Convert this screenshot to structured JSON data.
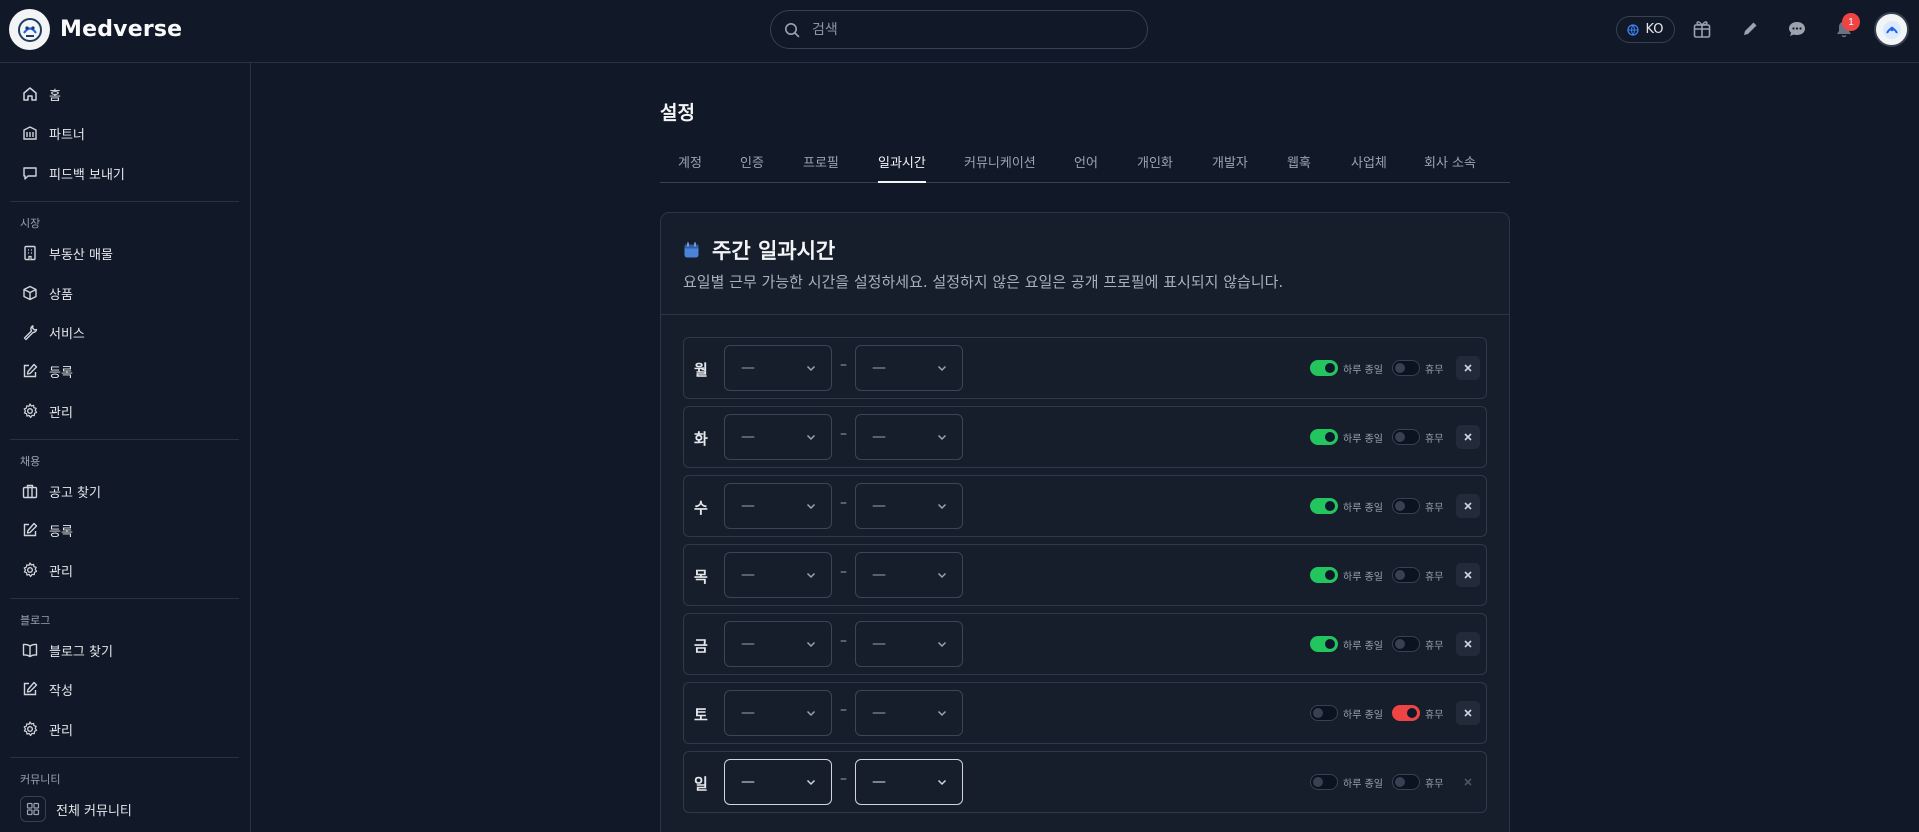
{
  "app": {
    "name": "Medverse"
  },
  "search": {
    "placeholder": "검색"
  },
  "topbar": {
    "language": "KO",
    "notification_count": "1"
  },
  "sidebar": {
    "main": [
      {
        "label": "홈",
        "icon": "home-icon"
      },
      {
        "label": "파트너",
        "icon": "building-icon"
      },
      {
        "label": "피드백 보내기",
        "icon": "message-icon"
      }
    ],
    "sections": [
      {
        "title": "시장",
        "items": [
          {
            "label": "부동산 매물",
            "icon": "office-icon"
          },
          {
            "label": "상품",
            "icon": "cube-icon"
          },
          {
            "label": "서비스",
            "icon": "wrench-icon"
          },
          {
            "label": "등록",
            "icon": "edit-icon"
          },
          {
            "label": "관리",
            "icon": "gear-icon"
          }
        ]
      },
      {
        "title": "채용",
        "items": [
          {
            "label": "공고 찾기",
            "icon": "briefcase-icon"
          },
          {
            "label": "등록",
            "icon": "edit-icon"
          },
          {
            "label": "관리",
            "icon": "gear-icon"
          }
        ]
      },
      {
        "title": "블로그",
        "items": [
          {
            "label": "블로그 찾기",
            "icon": "book-icon"
          },
          {
            "label": "작성",
            "icon": "edit-icon"
          },
          {
            "label": "관리",
            "icon": "gear-icon"
          }
        ]
      },
      {
        "title": "커뮤니티",
        "items": [
          {
            "label": "전체 커뮤니티",
            "icon": "grid-icon"
          }
        ]
      }
    ]
  },
  "page": {
    "title": "설정"
  },
  "tabs": [
    "계정",
    "인증",
    "프로필",
    "일과시간",
    "커뮤니케이션",
    "언어",
    "개인화",
    "개발자",
    "웹훅",
    "사업체",
    "회사 소속"
  ],
  "active_tab": "일과시간",
  "schedule": {
    "title": "주간 일과시간",
    "description": "요일별 근무 가능한 시간을 설정하세요. 설정하지 않은 요일은 공개 프로필에 표시되지 않습니다.",
    "full_day_label": "하루 종일",
    "day_off_label": "휴무",
    "separator": "–",
    "days": [
      {
        "day": "월",
        "start": "—",
        "end": "—",
        "full_day": true,
        "day_off": false
      },
      {
        "day": "화",
        "start": "—",
        "end": "—",
        "full_day": true,
        "day_off": false
      },
      {
        "day": "수",
        "start": "—",
        "end": "—",
        "full_day": true,
        "day_off": false
      },
      {
        "day": "목",
        "start": "—",
        "end": "—",
        "full_day": true,
        "day_off": false
      },
      {
        "day": "금",
        "start": "—",
        "end": "—",
        "full_day": true,
        "day_off": false
      },
      {
        "day": "토",
        "start": "—",
        "end": "—",
        "full_day": false,
        "day_off": true
      },
      {
        "day": "일",
        "start": "—",
        "end": "—",
        "full_day": false,
        "day_off": false
      }
    ]
  },
  "colors": {
    "background": "#111827",
    "card": "#161e2b",
    "toggle_on": "#22c55e",
    "day_off_on": "#ef4444",
    "badge": "#ef4444"
  }
}
